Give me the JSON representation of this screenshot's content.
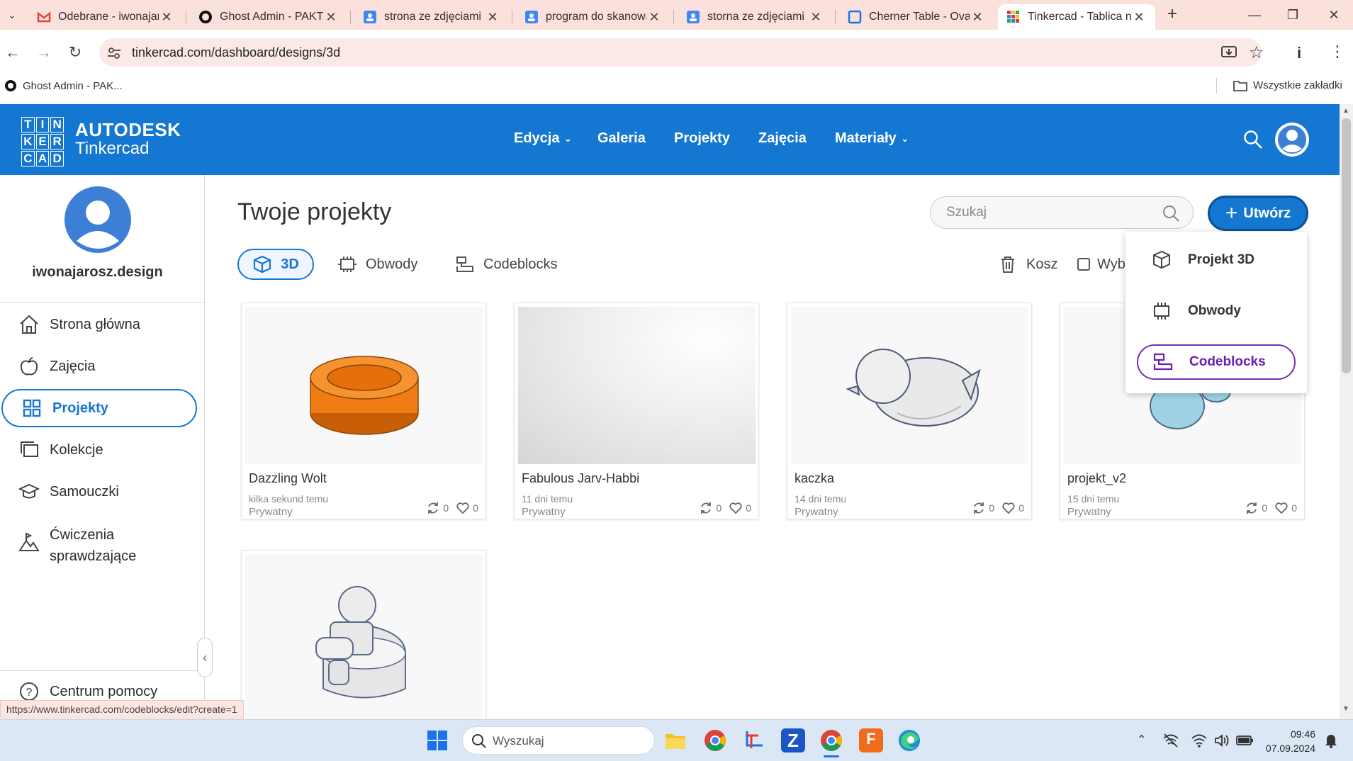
{
  "browser": {
    "tabs": [
      {
        "title": "Odebrane - iwonajar",
        "icon": "gmail-icon",
        "color": "#ea4335"
      },
      {
        "title": "Ghost Admin - PAKT",
        "icon": "ghost-icon",
        "color": "#111111"
      },
      {
        "title": "strona ze zdjęciami n",
        "icon": "doc-icon",
        "color": "#4285f4"
      },
      {
        "title": "program do skanowa",
        "icon": "doc-icon",
        "color": "#4285f4"
      },
      {
        "title": "storna ze zdjęciami n",
        "icon": "doc-icon",
        "color": "#4285f4"
      },
      {
        "title": "Cherner Table - Oval",
        "icon": "site-icon",
        "color": "#1a73e8"
      },
      {
        "title": "Tinkercad - Tablica n",
        "icon": "tinkercad-icon",
        "color": "#e53935"
      }
    ],
    "url": "tinkercad.com/dashboard/designs/3d",
    "bookmark": "Ghost Admin - PAK...",
    "all_bookmarks": "Wszystkie zakładki",
    "status_url": "https://www.tinkercad.com/codeblocks/edit?create=1"
  },
  "header": {
    "logo_letters": [
      "TIN",
      "KER",
      "CAD"
    ],
    "brand_top": "AUTODESK",
    "brand_bottom": "Tinkercad",
    "nav": [
      "Edycja",
      "Galeria",
      "Projekty",
      "Zajęcia",
      "Materiały"
    ]
  },
  "sidebar": {
    "username": "iwonajarosz.design",
    "items": [
      "Strona główna",
      "Zajęcia",
      "Projekty",
      "Kolekcje",
      "Samouczki",
      "Ćwiczenia sprawdzające"
    ],
    "help": "Centrum pomocy"
  },
  "main": {
    "title": "Twoje projekty",
    "search_placeholder": "Szukaj",
    "create_label": "Utwórz",
    "filters": [
      "3D",
      "Obwody",
      "Codeblocks"
    ],
    "trash": "Kosz",
    "select": "Wyb"
  },
  "dropdown": {
    "items": [
      "Projekt 3D",
      "Obwody",
      "Codeblocks"
    ]
  },
  "projects": [
    {
      "name": "Dazzling Wolt",
      "when": "kilka sekund temu",
      "privacy": "Prywatny",
      "remixes": "0",
      "likes": "0"
    },
    {
      "name": "Fabulous Jarv-Habbi",
      "when": "11 dni temu",
      "privacy": "Prywatny",
      "remixes": "0",
      "likes": "0"
    },
    {
      "name": "kaczka",
      "when": "14 dni temu",
      "privacy": "Prywatny",
      "remixes": "0",
      "likes": "0"
    },
    {
      "name": "projekt_v2",
      "when": "15 dni temu",
      "privacy": "Prywatny",
      "remixes": "0",
      "likes": "0"
    }
  ],
  "taskbar": {
    "search": "Wyszukaj",
    "time": "09:46",
    "date": "07.09.2024"
  },
  "colors": {
    "brand": "#1477d1",
    "accent_purple": "#7a2bb5",
    "orange": "#ef7d14"
  }
}
